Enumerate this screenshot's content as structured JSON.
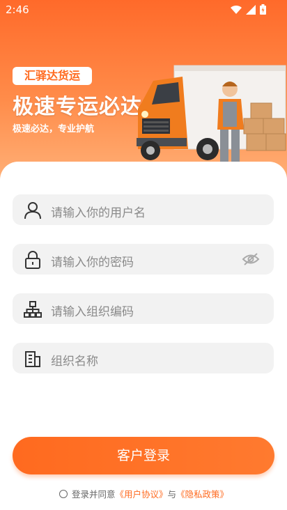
{
  "status_bar": {
    "time": "2:46"
  },
  "hero": {
    "badge": "汇驿达货运",
    "headline": "极速专运必达",
    "subtitle": "极速必达，专业护航"
  },
  "form": {
    "username_placeholder": "请输入你的用户名",
    "password_placeholder": "请输入你的密码",
    "org_code_placeholder": "请输入组织编码",
    "org_name_placeholder": "组织名称"
  },
  "login_button": "客户登录",
  "agreement": {
    "prefix": "登录并同意",
    "user_agreement": "《用户协议》",
    "joiner": "与",
    "privacy_policy": "《隐私政策》"
  },
  "colors": {
    "accent": "#ff6a1f",
    "field_bg": "#f2f2f2"
  }
}
